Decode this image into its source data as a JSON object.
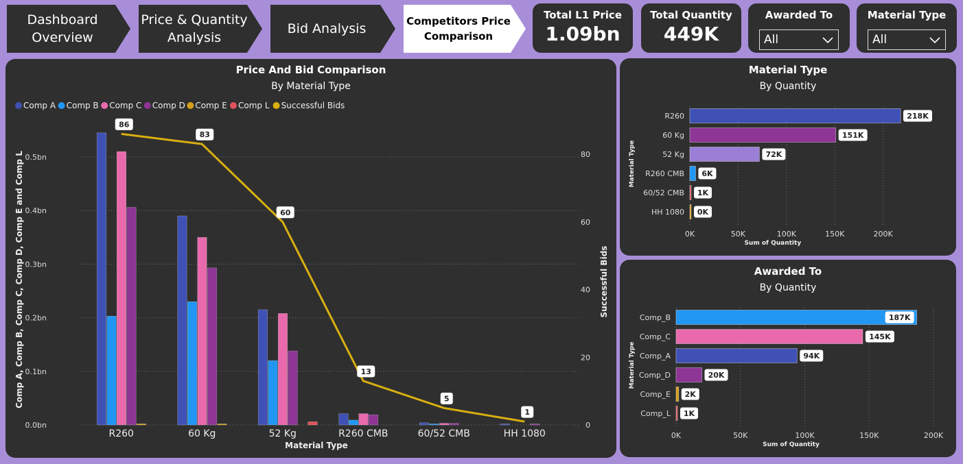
{
  "nav": {
    "dashboard": "Dashboard Overview",
    "price_qty": "Price & Quantity Analysis",
    "bid": "Bid Analysis",
    "competitors": "Competitors Price Comparison"
  },
  "kpis": {
    "l1_label": "Total L1 Price",
    "l1_value": "1.09bn",
    "qty_label": "Total Quantity",
    "qty_value": "449K"
  },
  "slicers": {
    "awarded_label": "Awarded To",
    "awarded_value": "All",
    "material_label": "Material Type",
    "material_value": "All"
  },
  "colors": {
    "Comp A": "#3f51b5",
    "Comp B": "#2196f3",
    "Comp C": "#e86aad",
    "Comp D": "#8e3596",
    "Comp E": "#d4a017",
    "Comp L": "#e0515a",
    "Successful Bids": "#d9b010",
    "lavender": "#9b7fd6"
  },
  "chart_data": [
    {
      "type": "bar",
      "title": "Price And Bid Comparison",
      "subtitle": "By Material Type",
      "xlabel": "Material Type",
      "ylabel": "Comp A, Comp B, Comp C, Comp D, Comp E and Comp L",
      "y2label": "Successful Bids",
      "categories": [
        "R260",
        "60 Kg",
        "52 Kg",
        "R260 CMB",
        "60/52 CMB",
        "HH 1080"
      ],
      "ylim": [
        0,
        0.55
      ],
      "y_ticks": [
        "0.0bn",
        "0.1bn",
        "0.2bn",
        "0.3bn",
        "0.4bn",
        "0.5bn"
      ],
      "y2lim": [
        0,
        90
      ],
      "y2_ticks": [
        "0",
        "20",
        "40",
        "60",
        "80"
      ],
      "legend_position": "top-left",
      "series": [
        {
          "name": "Comp A",
          "values": [
            0.545,
            0.39,
            0.215,
            0.021,
            0.004,
            0.001
          ]
        },
        {
          "name": "Comp B",
          "values": [
            0.203,
            0.23,
            0.12,
            0.009,
            0.001,
            0
          ]
        },
        {
          "name": "Comp C",
          "values": [
            0.51,
            0.35,
            0.208,
            0.021,
            0.003,
            0
          ]
        },
        {
          "name": "Comp D",
          "values": [
            0.406,
            0.293,
            0.138,
            0.019,
            0.003,
            0.001
          ]
        },
        {
          "name": "Comp E",
          "values": [
            0.002,
            0.001,
            0,
            0,
            0,
            0
          ]
        },
        {
          "name": "Comp L",
          "values": [
            0,
            0,
            0.006,
            0,
            0,
            0
          ]
        },
        {
          "name": "Successful Bids",
          "type": "line",
          "axis": "secondary",
          "values": [
            86,
            83,
            60,
            13,
            5,
            1
          ],
          "labels": [
            "86",
            "83",
            "60",
            "13",
            "5",
            "1"
          ]
        }
      ]
    },
    {
      "type": "bar",
      "orientation": "horizontal",
      "title": "Material Type",
      "subtitle": "By Quantity",
      "ylabel": "Material Type",
      "xlabel": "Sum of Quantity",
      "categories": [
        "R260",
        "60 Kg",
        "52 Kg",
        "R260 CMB",
        "60/52 CMB",
        "HH 1080"
      ],
      "values": [
        218,
        151,
        72,
        6,
        1,
        0
      ],
      "labels": [
        "218K",
        "151K",
        "72K",
        "6K",
        "1K",
        "0K"
      ],
      "xlim": [
        0,
        218
      ],
      "x_ticks": [
        "0K",
        "50K",
        "100K",
        "150K",
        "200K"
      ],
      "colors": [
        "#3f51b5",
        "#8e3596",
        "#9b7fd6",
        "#2196f3",
        "#e0515a",
        "#d4a017"
      ]
    },
    {
      "type": "bar",
      "orientation": "horizontal",
      "title": "Awarded To",
      "subtitle": "By Quantity",
      "ylabel": "Material Type",
      "xlabel": "Sum of Quantity",
      "categories": [
        "Comp_B",
        "Comp_C",
        "Comp_A",
        "Comp_D",
        "Comp_E",
        "Comp_L"
      ],
      "values": [
        187,
        145,
        94,
        20,
        2,
        1
      ],
      "labels": [
        "187K",
        "145K",
        "94K",
        "20K",
        "2K",
        "1K"
      ],
      "xlim": [
        0,
        200
      ],
      "x_ticks": [
        "0K",
        "50K",
        "100K",
        "150K",
        "200K"
      ],
      "colors": [
        "#2196f3",
        "#e86aad",
        "#3f51b5",
        "#8e3596",
        "#d4a017",
        "#e0515a"
      ]
    }
  ]
}
